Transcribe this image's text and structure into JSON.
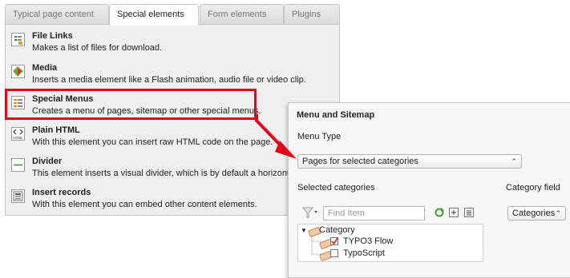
{
  "tabs": [
    {
      "label": "Typical page content"
    },
    {
      "label": "Special elements"
    },
    {
      "label": "Form elements"
    },
    {
      "label": "Plugins"
    }
  ],
  "active_tab": "Special elements",
  "items": [
    {
      "title": "File Links",
      "description": "Makes a list of files for download.",
      "icon": "file-links-icon"
    },
    {
      "title": "Media",
      "description": "Inserts a media element like a Flash animation, audio file or video clip.",
      "icon": "media-icon"
    },
    {
      "title": "Special Menus",
      "description": "Creates a menu of pages, sitemap or other special menus.",
      "icon": "menu-icon"
    },
    {
      "title": "Plain HTML",
      "description": "With this element you can insert raw HTML code on the page.",
      "icon": "html-icon"
    },
    {
      "title": "Divider",
      "description": "This element inserts a visual divider, which is by default a horizontal lin",
      "icon": "divider-icon"
    },
    {
      "title": "Insert records",
      "description": "With this element you can embed other content elements.",
      "icon": "records-icon"
    }
  ],
  "html_icon_text": "HTML",
  "panel": {
    "header": "Menu and Sitemap",
    "menu_type_label": "Menu Type",
    "menu_type_value": "Pages for selected categories",
    "selected_categories_label": "Selected categories",
    "category_field_label": "Category field",
    "category_field_value": "Categories",
    "search_placeholder": "Find Item",
    "tree": {
      "root": "Category",
      "children": [
        {
          "label": "TYPO3 Flow",
          "checked": true
        },
        {
          "label": "TypoScript",
          "checked": false
        }
      ]
    }
  },
  "colors": {
    "highlight": "#e2001a",
    "arrow": "#e2001a"
  }
}
